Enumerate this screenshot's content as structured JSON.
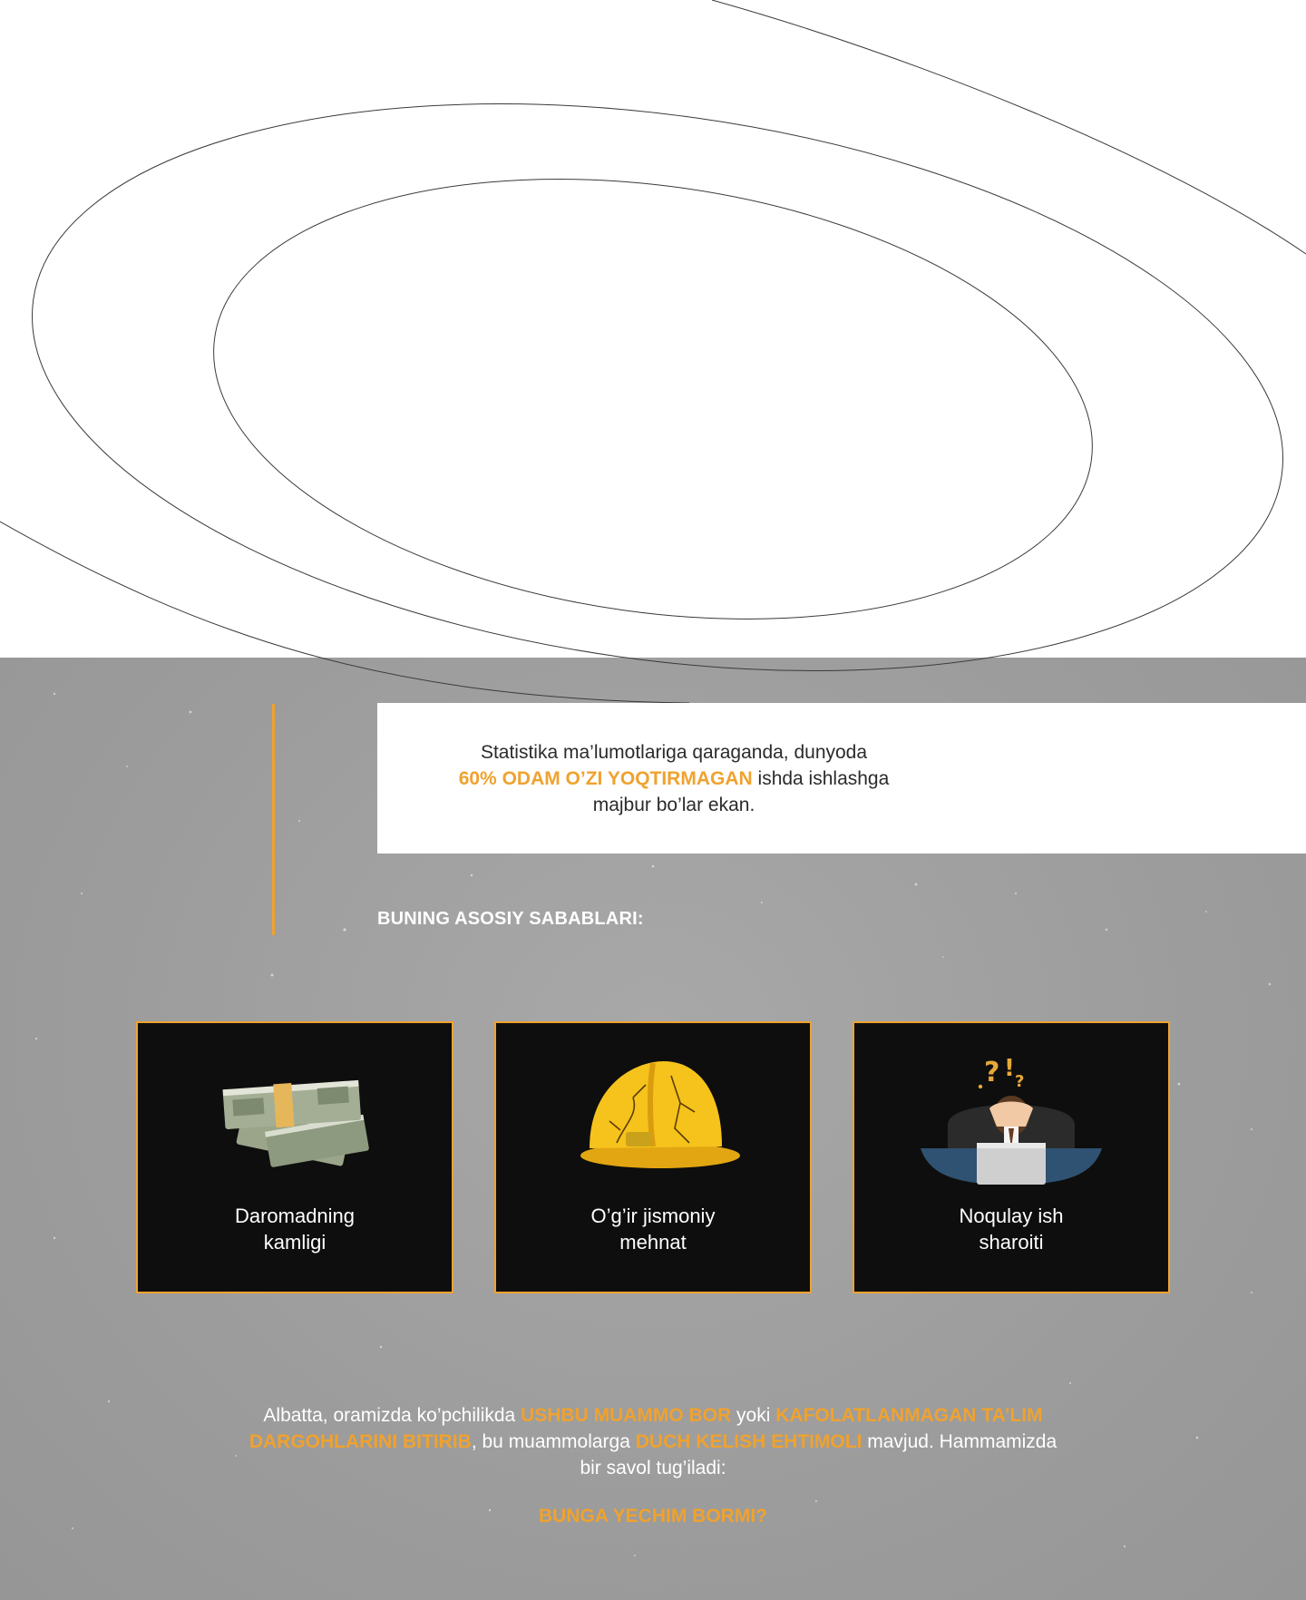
{
  "statistic": {
    "line1": "Statistika ma’lumotlariga qaraganda, dunyoda",
    "highlight": "60%  ODAM O’ZI YOQTIRMAGAN",
    "after_highlight": " ishda ishlashga",
    "line3": "majbur bo’lar ekan."
  },
  "causes": {
    "title": "BUNING ASOSIY SABABLARI:",
    "cards": [
      {
        "icon": "money-stack-icon",
        "line1": "Daromadning",
        "line2": "kamligi"
      },
      {
        "icon": "cracked-helmet-icon",
        "line1": "O’g’ir jismoniy",
        "line2": "mehnat"
      },
      {
        "icon": "stressed-worker-icon",
        "line1": "Noqulay ish",
        "line2": "sharoiti"
      }
    ]
  },
  "closing": {
    "p1": "Albatta, oramizda ko’pchilikda ",
    "h1": "USHBU MUAMMO BOR",
    "p2": " yoki ",
    "h2": "KAFOLATLANMAGAN TA’LIM DARGOHLARINI BITIRIB",
    "p3": ", bu muammolarga ",
    "h3": "DUCH KELISH EHTIMOLI",
    "p4": " mavjud. Hammamizda bir savol tug’iladi:",
    "question": "BUNGA YECHIM BORMI?"
  },
  "colors": {
    "accent": "#f0a22e",
    "card_bg": "#0e0e0e",
    "section_bg": "#9e9e9e"
  }
}
